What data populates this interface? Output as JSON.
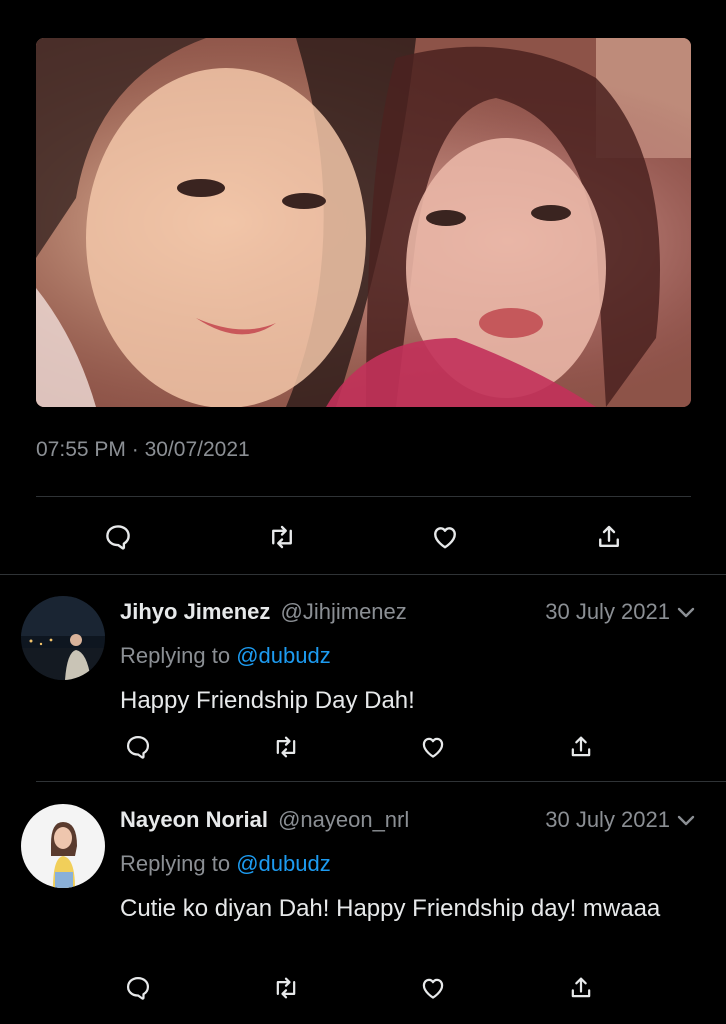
{
  "tweet": {
    "time": "07:55 PM",
    "separator": "·",
    "date": "30/07/2021",
    "actions": [
      {
        "icon": "reply-icon"
      },
      {
        "icon": "retweet-icon"
      },
      {
        "icon": "like-icon"
      },
      {
        "icon": "share-icon"
      }
    ]
  },
  "replies": [
    {
      "name": "Jihyo Jimenez",
      "handle": "@Jihjimenez",
      "date": "30 July 2021",
      "replying_prefix": "Replying to",
      "replying_to": "@dubudz",
      "text": "Happy Friendship Day Dah!"
    },
    {
      "name": "Nayeon Norial",
      "handle": "@nayeon_nrl",
      "date": "30 July 2021",
      "replying_prefix": "Replying to",
      "replying_to": "@dubudz",
      "text": "Cutie ko diyan Dah! Happy Friendship day! mwaaa"
    }
  ],
  "colors": {
    "background": "#000000",
    "text_primary": "#e7e9ea",
    "text_secondary": "#8b8f94",
    "link": "#1d9bf0",
    "divider": "#2f3336"
  }
}
